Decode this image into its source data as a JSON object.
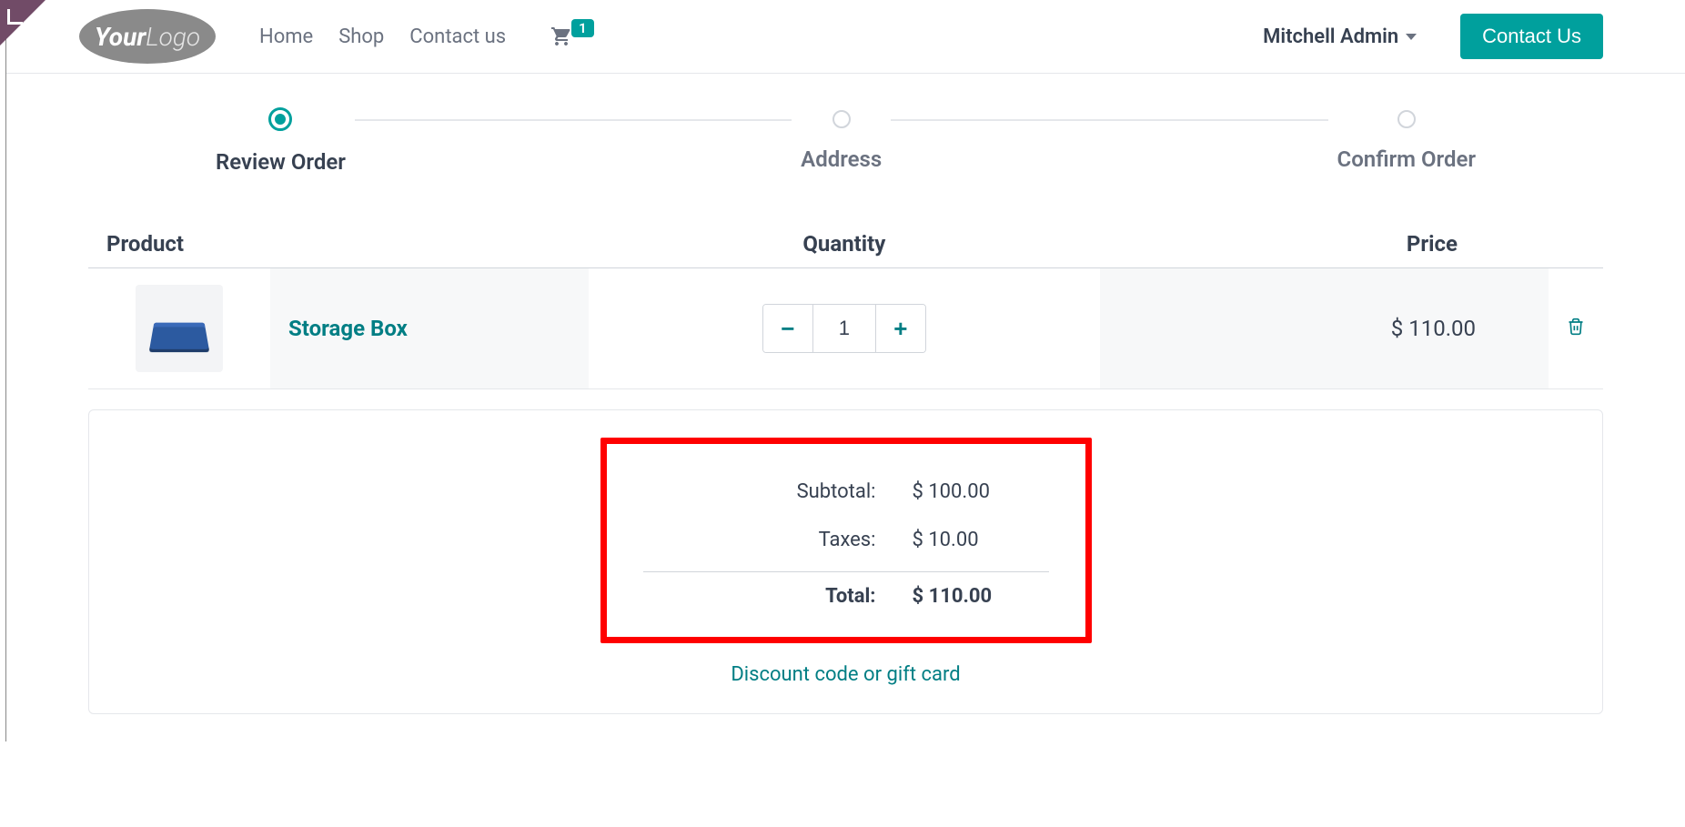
{
  "nav": {
    "home": "Home",
    "shop": "Shop",
    "contact": "Contact us",
    "cart_count": "1",
    "user": "Mitchell Admin",
    "contact_btn": "Contact Us"
  },
  "steps": {
    "review": "Review Order",
    "address": "Address",
    "confirm": "Confirm Order"
  },
  "cart": {
    "headers": {
      "product": "Product",
      "quantity": "Quantity",
      "price": "Price"
    },
    "item": {
      "name": "Storage Box",
      "qty": "1",
      "price": "$ 110.00"
    }
  },
  "summary": {
    "subtotal_label": "Subtotal:",
    "subtotal_value": "$ 100.00",
    "taxes_label": "Taxes:",
    "taxes_value": "$ 10.00",
    "total_label": "Total:",
    "total_value": "$ 110.00",
    "discount_link": "Discount code or gift card"
  }
}
